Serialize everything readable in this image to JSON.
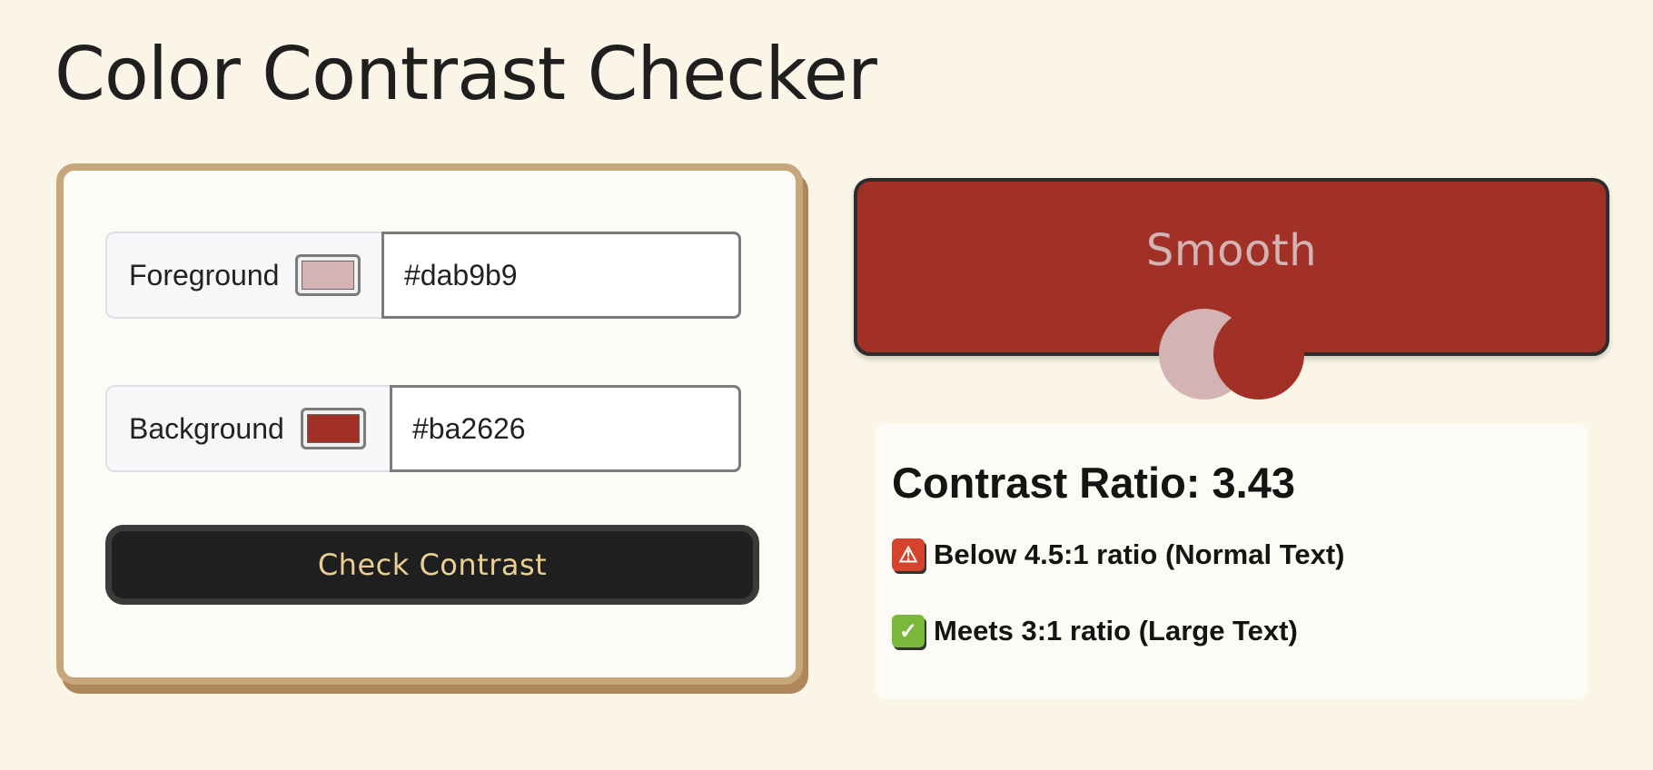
{
  "page": {
    "title": "Color Contrast Checker"
  },
  "form": {
    "foreground": {
      "label": "Foreground",
      "value": "#dab9b9",
      "swatch_color": "#d3b3b3"
    },
    "background": {
      "label": "Background",
      "value": "#ba2626",
      "swatch_color": "#a13127"
    },
    "check_button_label": "Check Contrast"
  },
  "preview": {
    "sample_text": "Smooth",
    "background_color": "#a13127",
    "text_color": "#d3b3b3"
  },
  "results": {
    "heading": "Contrast Ratio: 3.43",
    "normal_text": {
      "icon": "warning-icon",
      "text": "Below 4.5:1 ratio (Normal Text)"
    },
    "large_text": {
      "icon": "check-icon",
      "text": "Meets 3:1 ratio (Large Text)"
    }
  }
}
